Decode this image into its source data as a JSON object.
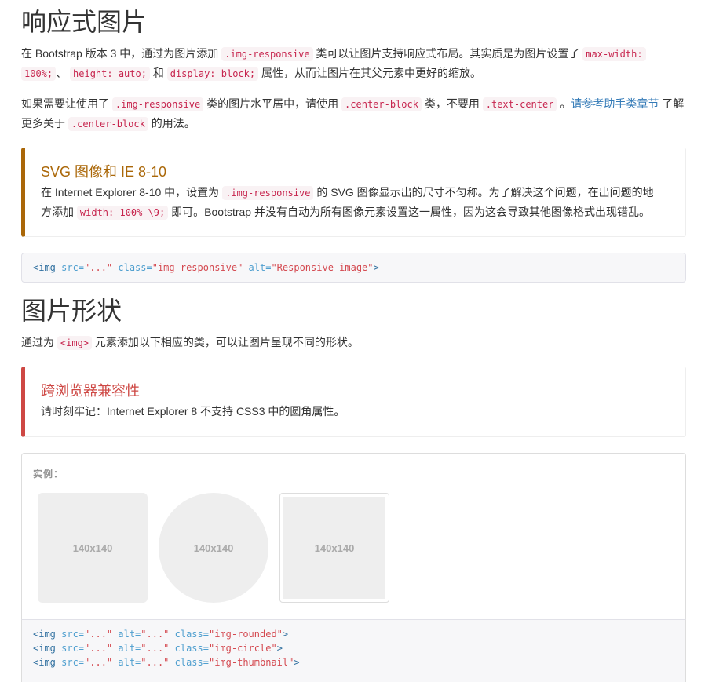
{
  "section1": {
    "title": "响应式图片",
    "p1": {
      "t1": "在 Bootstrap 版本 3 中，通过为图片添加 ",
      "c1": ".img-responsive",
      "t2": " 类可以让图片支持响应式布局。其实质是为图片设置了 ",
      "c2a": "max-width:",
      "c2b": "100%;",
      "t3": "、 ",
      "c3": "height: auto;",
      "t4": " 和 ",
      "c4": "display: block;",
      "t5": " 属性，从而让图片在其父元素中更好的缩放。"
    },
    "p2": {
      "t1": "如果需要让使用了 ",
      "c1": ".img-responsive",
      "t2": " 类的图片水平居中，请使用 ",
      "c2": ".center-block",
      "t3": " 类，不要用 ",
      "c3": ".text-center",
      "t4": " 。",
      "link": "请参考助手类章节",
      "t5": " 了解",
      "t6": "更多关于 ",
      "c4": ".center-block",
      "t7": " 的用法。"
    }
  },
  "callout_svg": {
    "title": "SVG 图像和 IE 8-10",
    "t1": "在 Internet Explorer 8-10 中，设置为 ",
    "c1": ".img-responsive",
    "t2": " 的 SVG 图像显示出的尺寸不匀称。为了解决这个问题，在出问题的地",
    "t3": "方添加 ",
    "c2": "width: 100% \\9;",
    "t4": " 即可。Bootstrap 并没有自动为所有图像元素设置这一属性，因为这会导致其他图像格式出现错乱。"
  },
  "code1": {
    "tag_open": "<img",
    "attr1": " src=",
    "val1": "\"...\"",
    "attr2": " class=",
    "val2": "\"img-responsive\"",
    "attr3": " alt=",
    "val3": "\"Responsive image\"",
    "tag_close": ">"
  },
  "section2": {
    "title": "图片形状",
    "t1": "通过为 ",
    "c1": "<img>",
    "t2": " 元素添加以下相应的类，可以让图片呈现不同的形状。"
  },
  "callout_compat": {
    "title": "跨浏览器兼容性",
    "text": "请时刻牢记：Internet Explorer 8 不支持 CSS3 中的圆角属性。"
  },
  "example": {
    "label": "实例：",
    "thumb1": "140x140",
    "thumb2": "140x140",
    "thumb3": "140x140",
    "lines": [
      {
        "tag": "<img",
        "a1": " src=",
        "v1": "\"...\"",
        "a2": " alt=",
        "v2": "\"...\"",
        "a3": " class=",
        "v3": "\"img-rounded\"",
        "end": ">"
      },
      {
        "tag": "<img",
        "a1": " src=",
        "v1": "\"...\"",
        "a2": " alt=",
        "v2": "\"...\"",
        "a3": " class=",
        "v3": "\"img-circle\"",
        "end": ">"
      },
      {
        "tag": "<img",
        "a1": " src=",
        "v1": "\"...\"",
        "a2": " alt=",
        "v2": "\"...\"",
        "a3": " class=",
        "v3": "\"img-thumbnail\"",
        "end": ">"
      }
    ]
  }
}
